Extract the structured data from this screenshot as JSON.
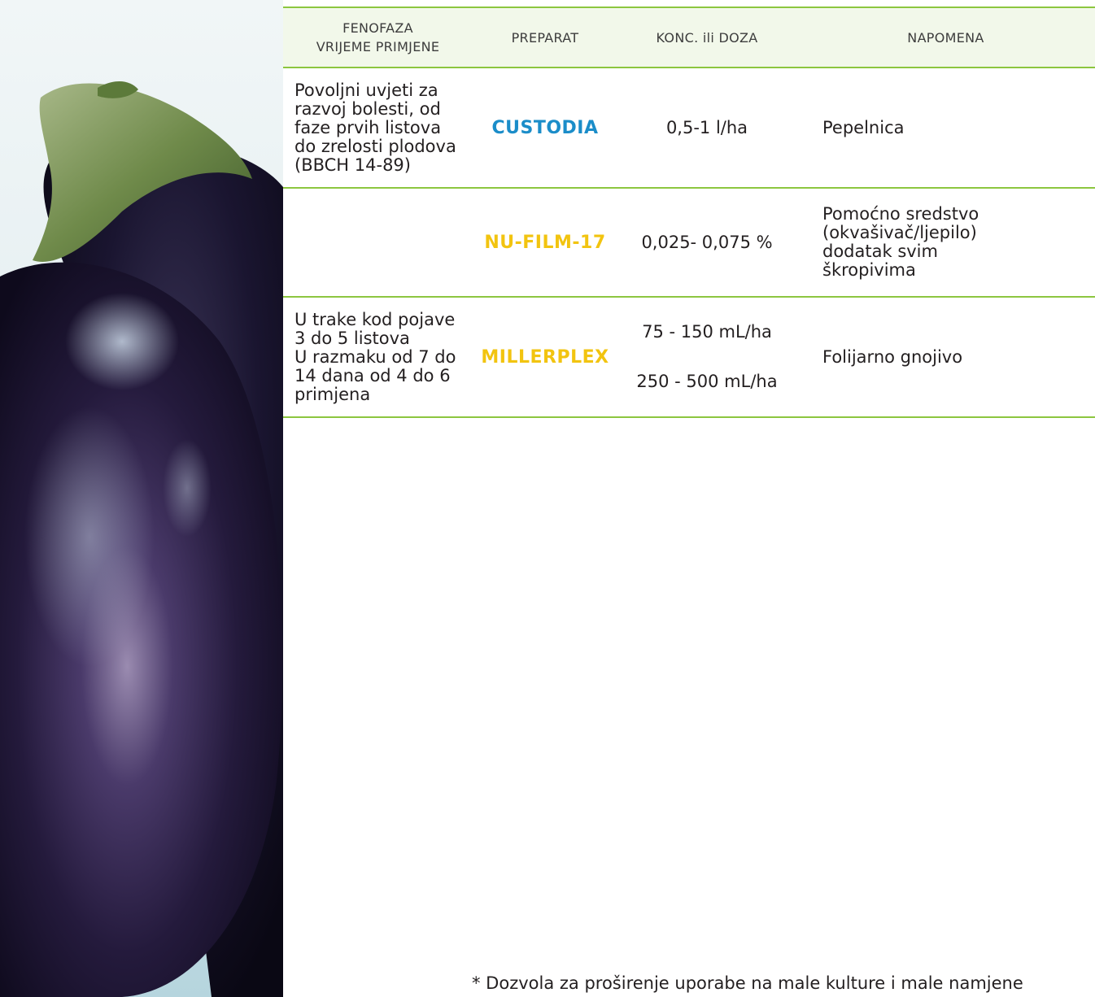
{
  "table": {
    "headers": {
      "phase": [
        "FENOFAZA",
        "VRIJEME PRIMJENE"
      ],
      "preparation": "PREPARAT",
      "dose": "KONC. ili DOZA",
      "note": "NAPOMENA"
    },
    "rows": [
      {
        "phase": [
          "Povoljni uvjeti za",
          "razvoj bolesti, od",
          "faze prvih listova",
          "do zrelosti plodova",
          "(BBCH 14-89)"
        ],
        "preparation": "CUSTODIA",
        "preparation_color": "#1b8dc9",
        "dose": [
          "0,5-1 l/ha"
        ],
        "note": "Pepelnica"
      },
      {
        "phase": [],
        "preparation": "NU-FILM-17",
        "preparation_color": "#f2c410",
        "dose": [
          "0,025- 0,075 %"
        ],
        "note": [
          "Pomoćno sredstvo",
          "(okvašivač/ljepilo)",
          "dodatak svim",
          "škropivima"
        ]
      },
      {
        "phase": [
          "U trake kod pojave",
          "3 do 5 listova",
          "U razmaku od 7 do",
          "14 dana od 4 do 6",
          "primjena"
        ],
        "preparation": "MILLERPLEX",
        "preparation_color": "#f2c410",
        "dose": [
          "75 - 150 mL/ha",
          "250 - 500 mL/ha"
        ],
        "note": "Folijarno gnojivo"
      }
    ]
  },
  "footnote": "* Dozvola za proširenje uporabe na male kulture i male namjene",
  "colors": {
    "rule_green": "#8cc63f",
    "header_bg": "#f2f8ea",
    "custodia_blue": "#1b8dc9",
    "product_yellow": "#f2c410"
  },
  "image": "eggplant-photo"
}
